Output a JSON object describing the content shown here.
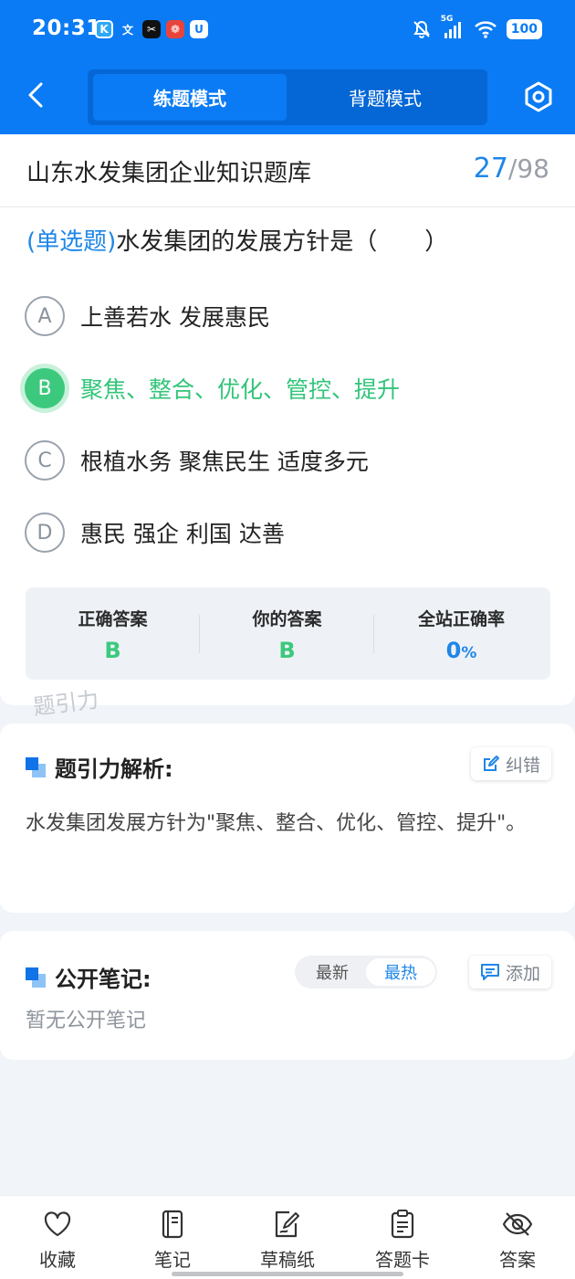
{
  "status_bar": {
    "time": "20:31",
    "network": "5G",
    "battery": "100"
  },
  "nav": {
    "modes": [
      "练题模式",
      "背题模式"
    ],
    "active_mode": "练题模式"
  },
  "bank": {
    "title": "山东水发集团企业知识题库",
    "current": "27",
    "separator": "/",
    "total": "98"
  },
  "question": {
    "type": "(单选题)",
    "text": "水发集团的发展方针是（　　）",
    "options": [
      {
        "letter": "A",
        "text": "上善若水 发展惠民"
      },
      {
        "letter": "B",
        "text": "聚焦、整合、优化、管控、提升"
      },
      {
        "letter": "C",
        "text": "根植水务 聚焦民生 适度多元"
      },
      {
        "letter": "D",
        "text": "惠民 强企 利国 达善"
      }
    ],
    "selected": "B"
  },
  "stats": {
    "correct_label": "正确答案",
    "correct_value": "B",
    "yours_label": "你的答案",
    "yours_value": "B",
    "rate_label": "全站正确率",
    "rate_value": "0",
    "rate_unit": "%"
  },
  "watermark": "题引力",
  "analysis": {
    "title": "题引力解析:",
    "error_button": "纠错",
    "text": "水发集团发展方针为\"聚焦、整合、优化、管控、提升\"。"
  },
  "notes": {
    "title": "公开笔记:",
    "sort_options": [
      "最新",
      "最热"
    ],
    "active_sort": "最热",
    "add_button": "添加",
    "empty_text": "暂无公开笔记"
  },
  "tabbar": [
    {
      "label": "收藏",
      "icon": "heart-icon"
    },
    {
      "label": "笔记",
      "icon": "notebook-icon"
    },
    {
      "label": "草稿纸",
      "icon": "draft-icon"
    },
    {
      "label": "答题卡",
      "icon": "answer-card-icon"
    },
    {
      "label": "答案",
      "icon": "eye-off-icon"
    }
  ],
  "colors": {
    "primary": "#0a7bf4",
    "correct": "#3cc97d",
    "accent": "#1f86e8"
  }
}
